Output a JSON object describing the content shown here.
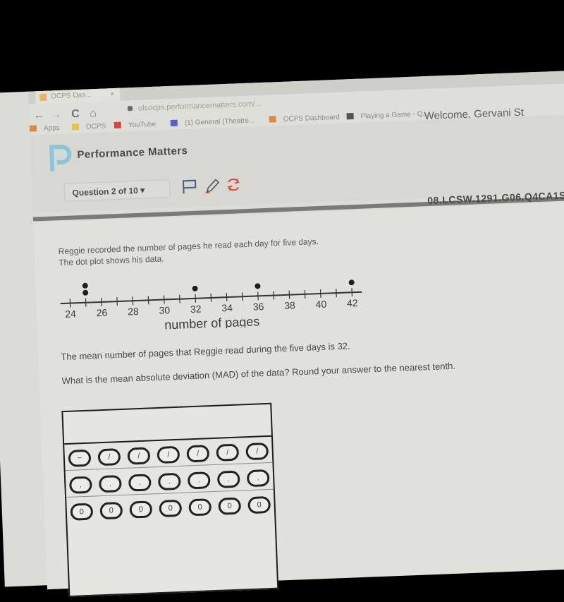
{
  "browser": {
    "tab_title": "OCPS Das...",
    "tab_close": "×",
    "back": "←",
    "forward": "→",
    "reload": "C",
    "home": "⌂",
    "url": "olsocps.performancematters.com/...",
    "bookmarks": [
      {
        "label": "Apps",
        "icon": "apps-grid-icon",
        "color": "#d98b4a"
      },
      {
        "label": "OCPS",
        "icon": "folder-icon",
        "color": "#e8c24a"
      },
      {
        "label": "YouTube",
        "icon": "youtube-icon",
        "color": "#d9463a"
      },
      {
        "label": "(1) General (Theatre...",
        "icon": "teams-icon",
        "color": "#5b5fc7"
      },
      {
        "label": "OCPS Dashboard",
        "icon": "dashboard-icon",
        "color": "#d98b4a"
      },
      {
        "label": "Playing a Game - Q...",
        "icon": "game-icon",
        "color": "#555555"
      }
    ]
  },
  "header": {
    "welcome": "Welcome, Gervani St",
    "brand": "Performance Matters",
    "question_selector": "Question 2 of 10 ▾",
    "tools": [
      "flag-icon",
      "pencil-icon",
      "refresh-icon"
    ],
    "standard_code": "08.LCSW.1291.G06.Q4CA1S"
  },
  "question": {
    "intro_line1": "Reggie recorded the number of pages he read each day for five days.",
    "intro_line2": "The dot plot shows his data.",
    "mean_statement": "The mean number of pages that Reggie read during the five days is 32.",
    "ask": "What is the mean absolute deviation (MAD) of the data?  Round your answer to the nearest tenth."
  },
  "chart_data": {
    "type": "scatter",
    "subtype": "dot-plot",
    "xlabel": "number of pages",
    "xlim": [
      24,
      42
    ],
    "x_ticks": [
      24,
      25,
      26,
      27,
      28,
      29,
      30,
      31,
      32,
      33,
      34,
      35,
      36,
      37,
      38,
      39,
      40,
      41,
      42
    ],
    "x_tick_labels": [
      "24",
      "26",
      "28",
      "30",
      "32",
      "34",
      "36",
      "38",
      "40",
      "42"
    ],
    "points": [
      {
        "x": 25,
        "count": 2
      },
      {
        "x": 32,
        "count": 1
      },
      {
        "x": 36,
        "count": 1
      },
      {
        "x": 42,
        "count": 1
      }
    ]
  },
  "answer_grid": {
    "columns": [
      [
        "−",
        ".",
        "0"
      ],
      [
        "/",
        ".",
        "0"
      ],
      [
        "/",
        ".",
        "0"
      ],
      [
        "/",
        ".",
        "0"
      ],
      [
        "/",
        ".",
        "0"
      ],
      [
        "/",
        ".",
        "0"
      ],
      [
        "/",
        ".",
        "0"
      ]
    ]
  }
}
